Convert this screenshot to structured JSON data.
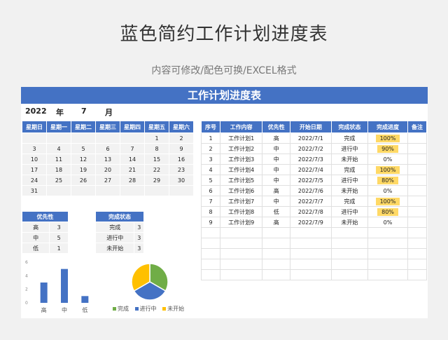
{
  "title": "蓝色简约工作计划进度表",
  "subtitle": "内容可修改/配色可换/EXCEL格式",
  "sheet_title": "工作计划进度表",
  "year": "2022",
  "year_label": "年",
  "month": "7",
  "month_label": "月",
  "calendar": {
    "headers": [
      "星期日",
      "星期一",
      "星期二",
      "星期三",
      "星期四",
      "星期五",
      "星期六"
    ],
    "rows": [
      [
        "",
        "",
        "",
        "",
        "",
        "1",
        "2"
      ],
      [
        "3",
        "4",
        "5",
        "6",
        "7",
        "8",
        "9"
      ],
      [
        "10",
        "11",
        "12",
        "13",
        "14",
        "15",
        "16"
      ],
      [
        "17",
        "18",
        "19",
        "20",
        "21",
        "22",
        "23"
      ],
      [
        "24",
        "25",
        "26",
        "27",
        "28",
        "29",
        "30"
      ],
      [
        "31",
        "",
        "",
        "",
        "",
        "",
        ""
      ]
    ]
  },
  "tasks": {
    "headers": [
      "序号",
      "工作内容",
      "优先性",
      "开始日期",
      "完成状态",
      "完成进度",
      "备注"
    ],
    "rows": [
      [
        "1",
        "工作计划1",
        "高",
        "2022/7/1",
        "完成",
        "100%",
        ""
      ],
      [
        "2",
        "工作计划2",
        "中",
        "2022/7/2",
        "进行中",
        "90%",
        ""
      ],
      [
        "3",
        "工作计划3",
        "中",
        "2022/7/3",
        "未开始",
        "0%",
        ""
      ],
      [
        "4",
        "工作计划4",
        "中",
        "2022/7/4",
        "完成",
        "100%",
        ""
      ],
      [
        "5",
        "工作计划5",
        "中",
        "2022/7/5",
        "进行中",
        "80%",
        ""
      ],
      [
        "6",
        "工作计划6",
        "高",
        "2022/7/6",
        "未开始",
        "0%",
        ""
      ],
      [
        "7",
        "工作计划7",
        "中",
        "2022/7/7",
        "完成",
        "100%",
        ""
      ],
      [
        "8",
        "工作计划8",
        "低",
        "2022/7/8",
        "进行中",
        "80%",
        ""
      ],
      [
        "9",
        "工作计划9",
        "高",
        "2022/7/9",
        "未开始",
        "0%",
        ""
      ],
      [
        "",
        "",
        "",
        "",
        "",
        "",
        ""
      ],
      [
        "",
        "",
        "",
        "",
        "",
        "",
        ""
      ],
      [
        "",
        "",
        "",
        "",
        "",
        "",
        ""
      ],
      [
        "",
        "",
        "",
        "",
        "",
        "",
        ""
      ],
      [
        "",
        "",
        "",
        "",
        "",
        "",
        ""
      ]
    ]
  },
  "priority": {
    "header": "优先性",
    "rows": [
      [
        "高",
        "3"
      ],
      [
        "中",
        "5"
      ],
      [
        "低",
        "1"
      ]
    ]
  },
  "status": {
    "header": "完成状态",
    "rows": [
      [
        "完成",
        "3"
      ],
      [
        "进行中",
        "3"
      ],
      [
        "未开始",
        "3"
      ]
    ]
  },
  "chart_data": [
    {
      "type": "bar",
      "categories": [
        "高",
        "中",
        "低"
      ],
      "values": [
        3,
        5,
        1
      ],
      "ylim": [
        0,
        6
      ],
      "yticks": [
        "6",
        "4",
        "2",
        "0"
      ],
      "color": "#4472c4"
    },
    {
      "type": "pie",
      "labels": [
        "完成",
        "进行中",
        "未开始"
      ],
      "values": [
        3,
        3,
        3
      ],
      "colors": [
        "#70ad47",
        "#4472c4",
        "#ffc000"
      ],
      "legend": "bottom"
    }
  ]
}
